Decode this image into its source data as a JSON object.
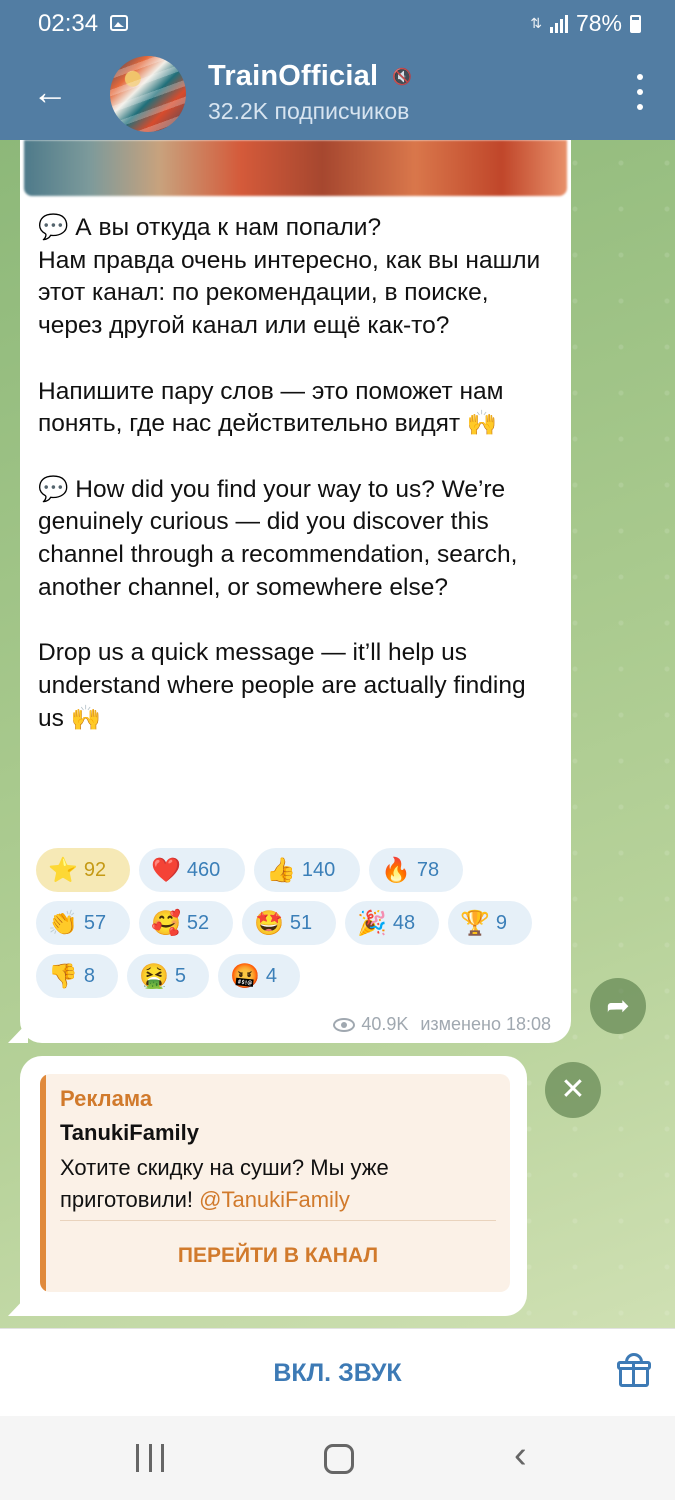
{
  "status": {
    "time": "02:34",
    "battery": "78%"
  },
  "header": {
    "title": "TrainOfficial",
    "subtitle": "32.2K подписчиков"
  },
  "message": {
    "text": "💬 А вы откуда к нам попали?\nНам правда очень интересно, как вы нашли этот канал: по рекомендации, в поиске, через другой канал или ещё как-то?\n\nНапишите пару слов — это поможет нам понять, где нас действительно видят 🙌\n\n💬 How did you find your way to us? We’re genuinely curious — did you discover this channel through a recommendation, search, another channel, or somewhere else?\n\nDrop us a quick message — it’ll help us understand where people are actually finding us 🙌",
    "reactions": [
      {
        "emoji": "⭐",
        "count": "92",
        "active": true
      },
      {
        "emoji": "❤️",
        "count": "460"
      },
      {
        "emoji": "👍",
        "count": "140"
      },
      {
        "emoji": "🔥",
        "count": "78"
      },
      {
        "emoji": "👏",
        "count": "57"
      },
      {
        "emoji": "🥰",
        "count": "52"
      },
      {
        "emoji": "🤩",
        "count": "51"
      },
      {
        "emoji": "🎉",
        "count": "48"
      },
      {
        "emoji": "🏆",
        "count": "9"
      },
      {
        "emoji": "👎",
        "count": "8"
      },
      {
        "emoji": "🤮",
        "count": "5"
      },
      {
        "emoji": "🤬",
        "count": "4"
      }
    ],
    "views": "40.9K",
    "edited": "изменено 18:08"
  },
  "ad": {
    "label": "Реклама",
    "name": "TanukiFamily",
    "text": "Хотите скидку на суши? Мы уже приготовили! ",
    "link": "@TanukiFamily",
    "cta": "ПЕРЕЙТИ В КАНАЛ"
  },
  "bottom": {
    "unmute": "ВКЛ. ЗВУК"
  },
  "icons": {
    "back": "arrow-left-icon",
    "mute": "mute-icon",
    "menu": "kebab-menu-icon",
    "share": "share-icon",
    "close": "close-icon",
    "gift": "gift-icon"
  },
  "colors": {
    "header": "#527da3",
    "accent": "#3d7ab5",
    "ad_accent": "#d17a2c"
  }
}
